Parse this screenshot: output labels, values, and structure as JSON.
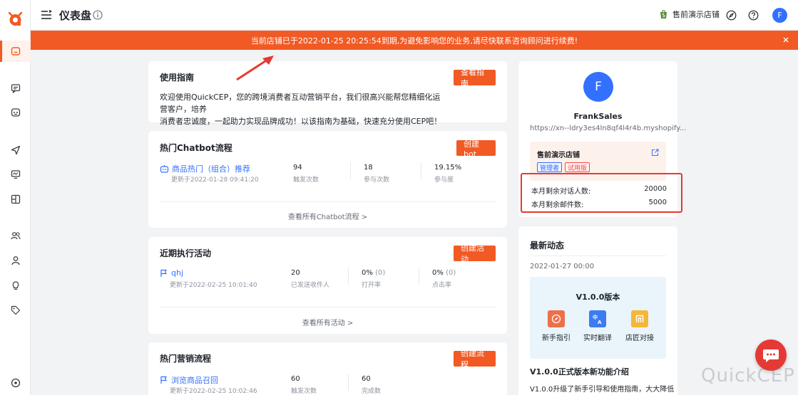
{
  "header": {
    "title": "仪表盘",
    "store_name": "售前演示店铺",
    "avatar_letter": "F"
  },
  "banner": {
    "text": "当前店铺已于2022-01-25 20:25:54到期,为避免影响您的业务,请尽快联系咨询顾问进行续费!"
  },
  "guide": {
    "title": "使用指南",
    "button": "查看指南",
    "line1": "欢迎使用QuickCEP，您的跨境消费者互动营销平台，我们很高兴能帮您精细化运营客户，培养",
    "line2": "消费者忠诚度，一起助力实现品牌成功！以该指南为基础，快速充分使用CEP吧！"
  },
  "chatbot": {
    "title": "热门Chatbot流程",
    "button": "创建bot",
    "item": {
      "name": "商品热门（组合）推荐",
      "updated": "更新于2022-01-28 09:41:20",
      "stat1_value": "94",
      "stat1_label": "触发次数",
      "stat2_value": "18",
      "stat2_label": "参与次数",
      "stat3_value": "19.15%",
      "stat3_label": "参与度"
    },
    "more": "查看所有Chatbot流程 >"
  },
  "campaign": {
    "title": "近期执行活动",
    "button": "创建活动",
    "item": {
      "name": "qhj",
      "updated": "更新于2022-02-25 10:01:40",
      "stat1_value": "20",
      "stat1_label": "已发送收件人",
      "stat2_value": "0%",
      "stat2_extra": "(0)",
      "stat2_label": "打开率",
      "stat3_value": "0%",
      "stat3_extra": "(0)",
      "stat3_label": "点击率"
    },
    "more": "查看所有活动 >"
  },
  "marketing": {
    "title": "热门营销流程",
    "button": "创建流程",
    "item": {
      "name": "浏览商品召回",
      "updated": "更新于2022-02-25 10:02:46",
      "stat1_value": "60",
      "stat1_label": "触发次数",
      "stat2_value": "60",
      "stat2_label": "完成数"
    }
  },
  "profile": {
    "avatar_letter": "F",
    "name": "FrankSales",
    "shop_url": "https://xn--ldry3es4ln8qf4l4r4b.myshopify...",
    "store_name": "售前演示店铺",
    "tag_admin": "管理者",
    "tag_trial": "试用版",
    "quota1_label": "本月剩余对话人数:",
    "quota1_value": "20000",
    "quota2_label": "本月剩余邮件数:",
    "quota2_value": "5000"
  },
  "news": {
    "title": "最新动态",
    "date": "2022-01-27 00:00",
    "version_title": "V1.0.0版本",
    "features": [
      "新手指引",
      "实时翻译",
      "店匠对接"
    ],
    "headline": "V1.0.0正式版本新功能介绍",
    "body": "V1.0.0升级了新手引导和使用指南，大大降低"
  },
  "watermark": "QuickCEP",
  "colors": {
    "accent": "#f15a24",
    "link": "#3370ff",
    "highlight_border": "#e53935"
  }
}
